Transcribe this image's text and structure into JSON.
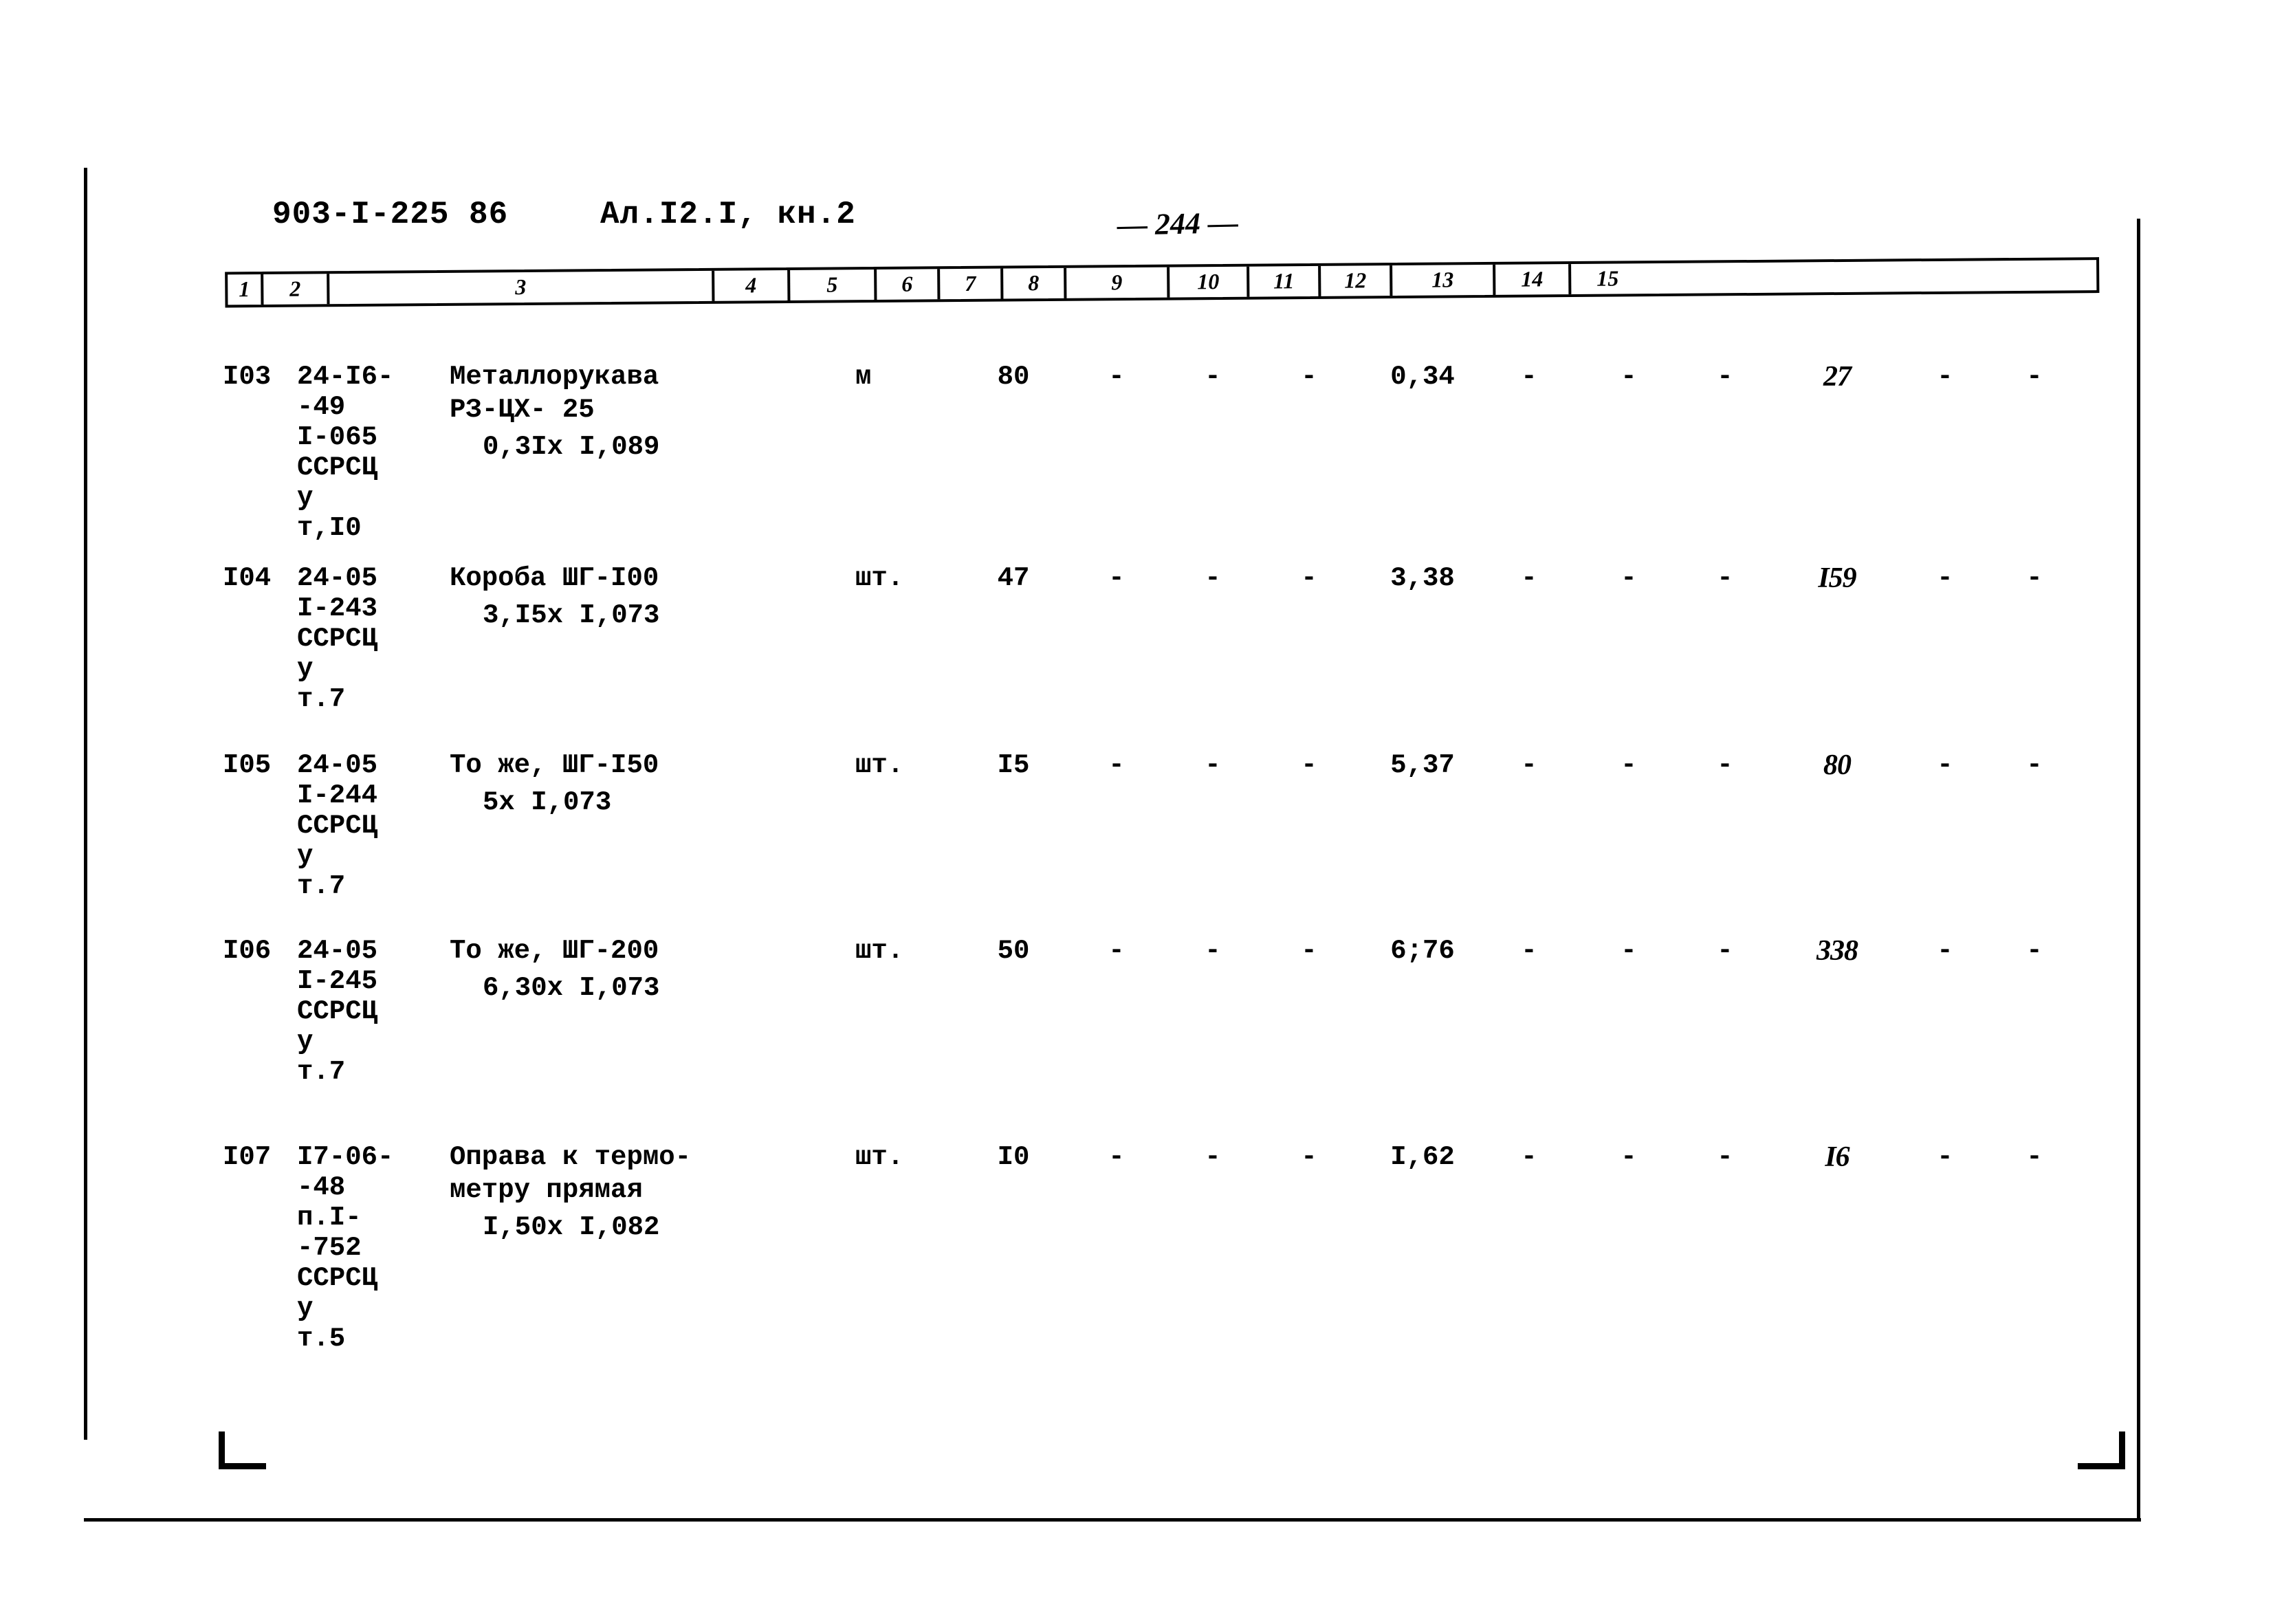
{
  "document": {
    "code": "903-I-225 86",
    "album": "Ал.I2.I, кн.2",
    "page_label": "— 244 —"
  },
  "table": {
    "column_headers": [
      "1",
      "2",
      "3",
      "4",
      "5",
      "6",
      "7",
      "8",
      "9",
      "10",
      "11",
      "12",
      "13",
      "14",
      "15"
    ],
    "rows": [
      {
        "num": "I03",
        "code_lines": [
          "24-I6-",
          "-49",
          "I-065",
          "ССРСЦ",
          "у",
          "т,I0"
        ],
        "name_lines": [
          "Металлорукава",
          "РЗ-ЦХ- 25"
        ],
        "spec": "0,3Iх I,089",
        "unit": "м",
        "qty": "80",
        "c6": "-",
        "c7": "-",
        "c8": "-",
        "c9": "0,34",
        "c10": "-",
        "c11": "-",
        "c12": "-",
        "c13": "27",
        "c14": "-",
        "c15": "-"
      },
      {
        "num": "I04",
        "code_lines": [
          "24-05",
          "I-243",
          "ССРСЦ",
          "у",
          "т.7"
        ],
        "name_lines": [
          "Короба ШГ-I00"
        ],
        "spec": "3,I5х I,073",
        "unit": "шт.",
        "qty": "47",
        "c6": "-",
        "c7": "-",
        "c8": "-",
        "c9": "3,38",
        "c10": "-",
        "c11": "-",
        "c12": "-",
        "c13": "I59",
        "c14": "-",
        "c15": "-"
      },
      {
        "num": "I05",
        "code_lines": [
          "24-05",
          "I-244",
          "ССРСЦ",
          "у",
          "т.7"
        ],
        "name_lines": [
          "То же, ШГ-I50"
        ],
        "spec": "5х I,073",
        "unit": "шт.",
        "qty": "I5",
        "c6": "-",
        "c7": "-",
        "c8": "-",
        "c9": "5,37",
        "c10": "-",
        "c11": "-",
        "c12": "-",
        "c13": "80",
        "c14": "-",
        "c15": "-"
      },
      {
        "num": "I06",
        "code_lines": [
          "24-05",
          "I-245",
          "ССРСЦ",
          "у",
          "т.7"
        ],
        "name_lines": [
          "То же, ШГ-200"
        ],
        "spec": "6,30х I,073",
        "unit": "шт.",
        "qty": "50",
        "c6": "-",
        "c7": "-",
        "c8": "-",
        "c9": "6;76",
        "c10": "-",
        "c11": "-",
        "c12": "-",
        "c13": "338",
        "c14": "-",
        "c15": "-"
      },
      {
        "num": "I07",
        "code_lines": [
          "I7-06-",
          "-48",
          "п.I-",
          "-752",
          "ССРСЦ",
          "у",
          "т.5"
        ],
        "name_lines": [
          "Оправа к термо-",
          "метру прямая"
        ],
        "spec": "I,50х I,082",
        "unit": "шт.",
        "qty": "I0",
        "c6": "-",
        "c7": "-",
        "c8": "-",
        "c9": "I,62",
        "c10": "-",
        "c11": "-",
        "c12": "-",
        "c13": "I6",
        "c14": "-",
        "c15": "-"
      }
    ]
  }
}
